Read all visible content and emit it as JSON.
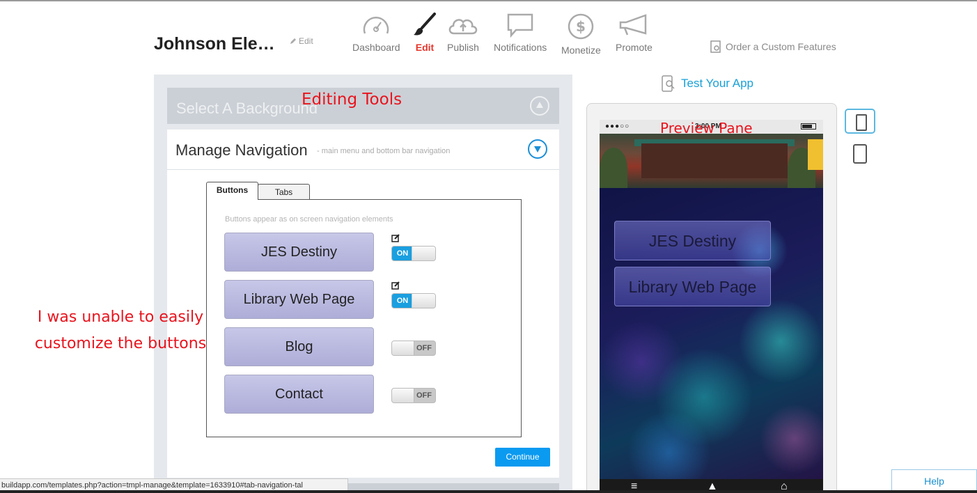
{
  "header": {
    "app_title": "Johnson Ele…",
    "title_edit": "Edit",
    "nav": [
      {
        "label": "Dashboard",
        "icon": "gauge-icon"
      },
      {
        "label": "Edit",
        "icon": "brush-icon",
        "active": true
      },
      {
        "label": "Publish",
        "icon": "cloud-upload-icon"
      },
      {
        "label": "Notifications",
        "icon": "speech-bubble-icon"
      },
      {
        "label": "Monetize",
        "icon": "dollar-icon"
      },
      {
        "label": "Promote",
        "icon": "megaphone-icon"
      }
    ],
    "order_link": "Order a Custom Features"
  },
  "editor": {
    "background_section": "Select A Background",
    "navigation_title": "Manage Navigation",
    "navigation_subtitle": "- main menu and bottom bar navigation",
    "tabs": [
      "Buttons",
      "Tabs"
    ],
    "hint": "Buttons appear as on screen navigation elements",
    "buttons": [
      {
        "label": "JES Destiny",
        "state": "ON",
        "editable": true
      },
      {
        "label": "Library Web Page",
        "state": "ON",
        "editable": true
      },
      {
        "label": "Blog",
        "state": "OFF",
        "editable": false
      },
      {
        "label": "Contact",
        "state": "OFF",
        "editable": false
      }
    ],
    "continue_label": "Continue"
  },
  "preview": {
    "test_link": "Test Your App",
    "carrier": "●●●○○ ",
    "time": "3:00 PM",
    "buttons": [
      "JES Destiny",
      "Library Web Page"
    ]
  },
  "annotations": {
    "editing_tools": "Editing Tools",
    "preview_pane": "Preview Pane",
    "left_note_line1": "I was unable to easily",
    "left_note_line2": "customize the buttons"
  },
  "status_url": "buildapp.com/templates.php?action=tmpl-manage&template=1633910#tab-navigation-tal",
  "help_label": "Help",
  "colors": {
    "accent": "#1a9fe0",
    "active_nav": "#e8352a",
    "annotation": "#e8141e"
  }
}
